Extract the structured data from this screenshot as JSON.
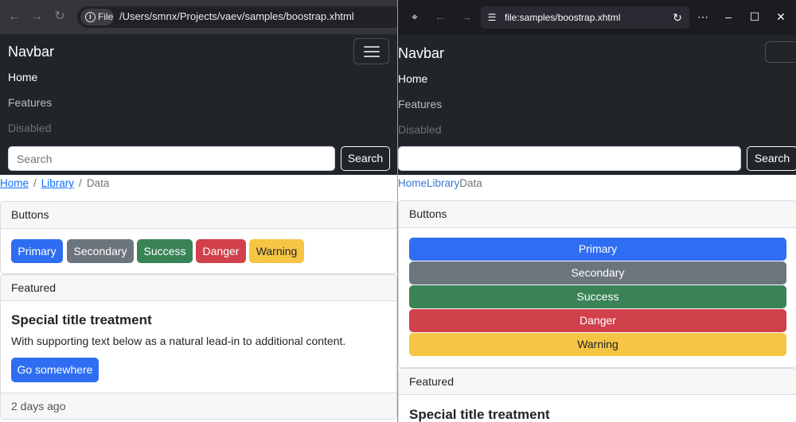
{
  "left": {
    "toolbar": {
      "icons": {
        "back": "arrow-left-icon",
        "forward": "arrow-right-icon",
        "reload": "reload-icon",
        "info": "info-icon"
      },
      "file_chip": "File",
      "url": "/Users/smnx/Projects/vaev/samples/boostrap.xhtml"
    },
    "navbar": {
      "brand": "Navbar",
      "links": [
        "Home",
        "Features",
        "Disabled"
      ],
      "search_placeholder": "Search",
      "search_button": "Search"
    },
    "breadcrumb": {
      "items": [
        "Home",
        "Library",
        "Data"
      ],
      "separator": "/"
    },
    "buttons_card": {
      "header": "Buttons",
      "buttons": [
        "Primary",
        "Secondary",
        "Success",
        "Danger",
        "Warning"
      ]
    },
    "featured_card": {
      "header": "Featured",
      "title": "Special title treatment",
      "text": "With supporting text below as a natural lead-in to additional content.",
      "button": "Go somewhere",
      "footer": "2 days ago"
    }
  },
  "right": {
    "toolbar": {
      "icons": {
        "app": "broom-icon",
        "back": "arrow-left-icon",
        "forward": "arrow-right-icon",
        "tune": "tune-icon",
        "reload": "reload-icon",
        "more": "more-icon",
        "minimize": "minimize-icon",
        "maximize": "maximize-icon",
        "close": "close-icon"
      },
      "url": "file:samples/boostrap.xhtml"
    },
    "navbar": {
      "brand": "Navbar",
      "links": [
        "Home",
        "Features",
        "Disabled"
      ],
      "search_button": "Search"
    },
    "breadcrumb": {
      "items": [
        "Home",
        "Library",
        "Data"
      ]
    },
    "buttons_card": {
      "header": "Buttons",
      "buttons": [
        "Primary",
        "Secondary",
        "Success",
        "Danger",
        "Warning"
      ]
    },
    "featured_card": {
      "header": "Featured",
      "title": "Special title treatment"
    }
  },
  "colors": {
    "primary": "#2f6ef2",
    "secondary": "#6c757d",
    "success": "#3a8357",
    "danger": "#d0414c",
    "warning": "#f6c544",
    "navbar_bg": "#212529"
  }
}
